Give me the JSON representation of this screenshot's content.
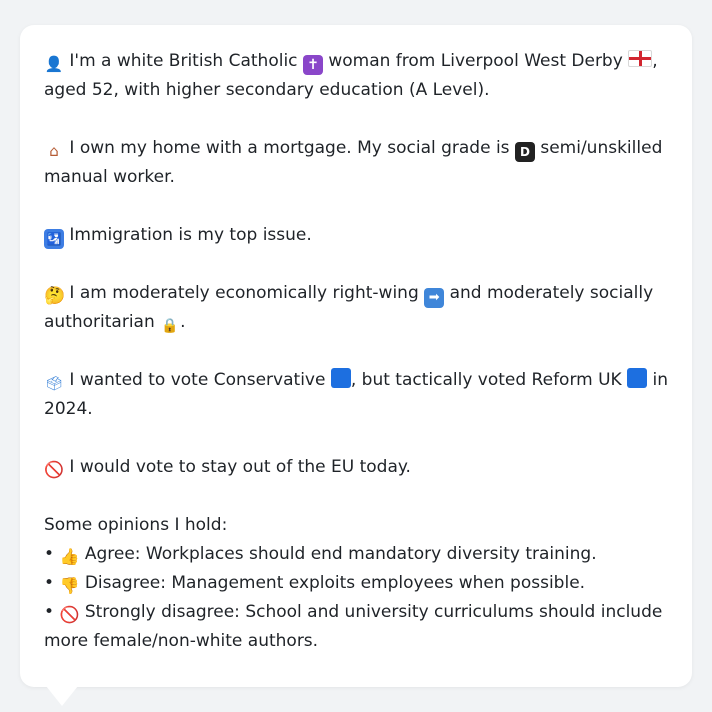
{
  "profile": {
    "p1": {
      "icon_person": "👤",
      "t1": "I'm a white British Catholic",
      "icon_cross": "✝",
      "t2": "woman from Liverpool West Derby",
      "t3": ",",
      "t4": "aged 52, with higher secondary education (A Level)."
    },
    "p2": {
      "icon_house": "⌂",
      "t1": "I own my home with a mortgage. My social grade is",
      "icon_grade": "D",
      "t2": "semi/unskilled",
      "t3": "manual worker."
    },
    "p3": {
      "icon_passport": "🛂",
      "t1": "Immigration is my top issue."
    },
    "p4": {
      "icon_think": "🤔",
      "t1": "I am moderately economically right-wing",
      "icon_arrow": "➡",
      "t2": "and moderately socially",
      "t3": "authoritarian",
      "icon_lock": "🔒",
      "t4": "."
    },
    "p5": {
      "icon_ballot": "🗳",
      "t1": "I wanted to vote Conservative",
      "t2": ", but tactically voted Reform UK",
      "t3": "in",
      "t4": "2024."
    },
    "p6": {
      "icon_no": "🚫",
      "t1": "I would vote to stay out of the EU today."
    },
    "opinions": {
      "heading": "Some opinions I hold:",
      "bullet": "•",
      "o1": {
        "icon": "👍",
        "text": "Agree: Workplaces should end mandatory diversity training."
      },
      "o2": {
        "icon": "👎",
        "text": "Disagree: Management exploits employees when possible."
      },
      "o3": {
        "icon": "🚫",
        "text": "Strongly disagree: School and university curriculums should include",
        "text2": "more female/non-white authors."
      }
    }
  },
  "icons": {
    "person": "person-icon",
    "cross": "latin-cross-icon",
    "flag": "england-flag-icon",
    "house": "house-icon",
    "grade": "letter-d-icon",
    "passport": "passport-control-icon",
    "think": "thinking-face-icon",
    "arrow": "right-arrow-icon",
    "lock": "lock-icon",
    "ballot": "ballot-box-icon",
    "blue_square": "blue-square-icon",
    "no_entry": "prohibited-icon",
    "thumbs_up": "thumbs-up-icon",
    "thumbs_down": "thumbs-down-icon"
  },
  "colors": {
    "background": "#f1f3f5",
    "bubble": "#ffffff",
    "text": "#1f2328",
    "conservative_blue": "#1d6fe0",
    "reform_blue": "#1d6fe0"
  }
}
